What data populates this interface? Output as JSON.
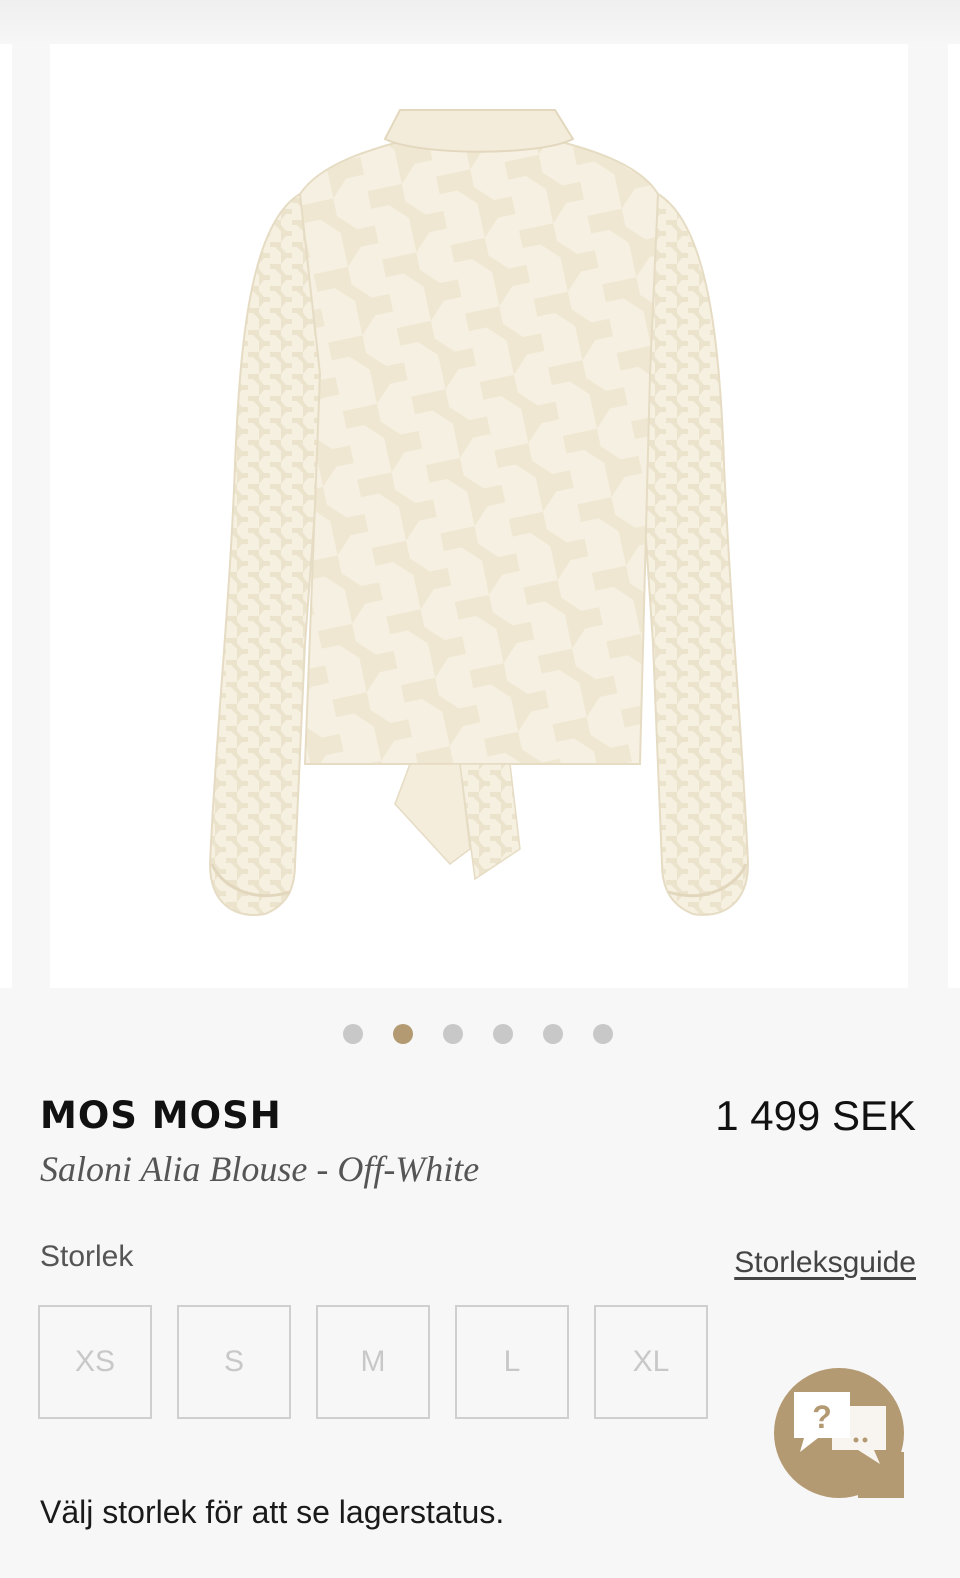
{
  "gallery": {
    "image_alt": "Saloni Alia Blouse - Off-White back view",
    "slide_count": 6,
    "active_index": 1
  },
  "product": {
    "brand": "MOS MOSH",
    "name": "Saloni Alia Blouse - Off-White",
    "price": "1 499 SEK"
  },
  "size_section": {
    "label": "Storlek",
    "guide_link": "Storleksguide",
    "sizes": [
      "XS",
      "S",
      "M",
      "L",
      "XL"
    ],
    "stock_message": "Välj storlek för att se lagerstatus."
  },
  "help": {
    "icon": "chat-help-icon",
    "glyph": "?"
  },
  "colors": {
    "accent": "#b39a72",
    "dot_inactive": "#c8c8c8",
    "blouse": "#f5efe0"
  }
}
